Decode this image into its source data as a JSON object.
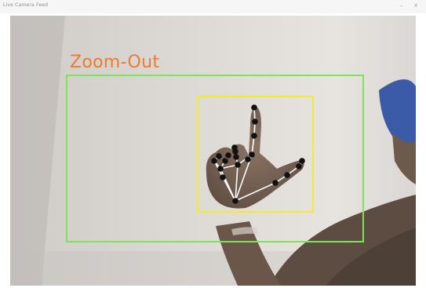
{
  "window": {
    "title": "Live Camera Feed",
    "controls": [
      "–",
      "×"
    ]
  },
  "detection": {
    "gesture_label": "Zoom-Out"
  },
  "colors": {
    "gesture_label": "#ee7a30",
    "outer_box": "#7fe35a",
    "hand_box": "#f4ea30",
    "landmark": "#111111",
    "connection": "#ffffff"
  },
  "icons": {
    "minimize": "minimize-icon",
    "close": "close-icon"
  }
}
